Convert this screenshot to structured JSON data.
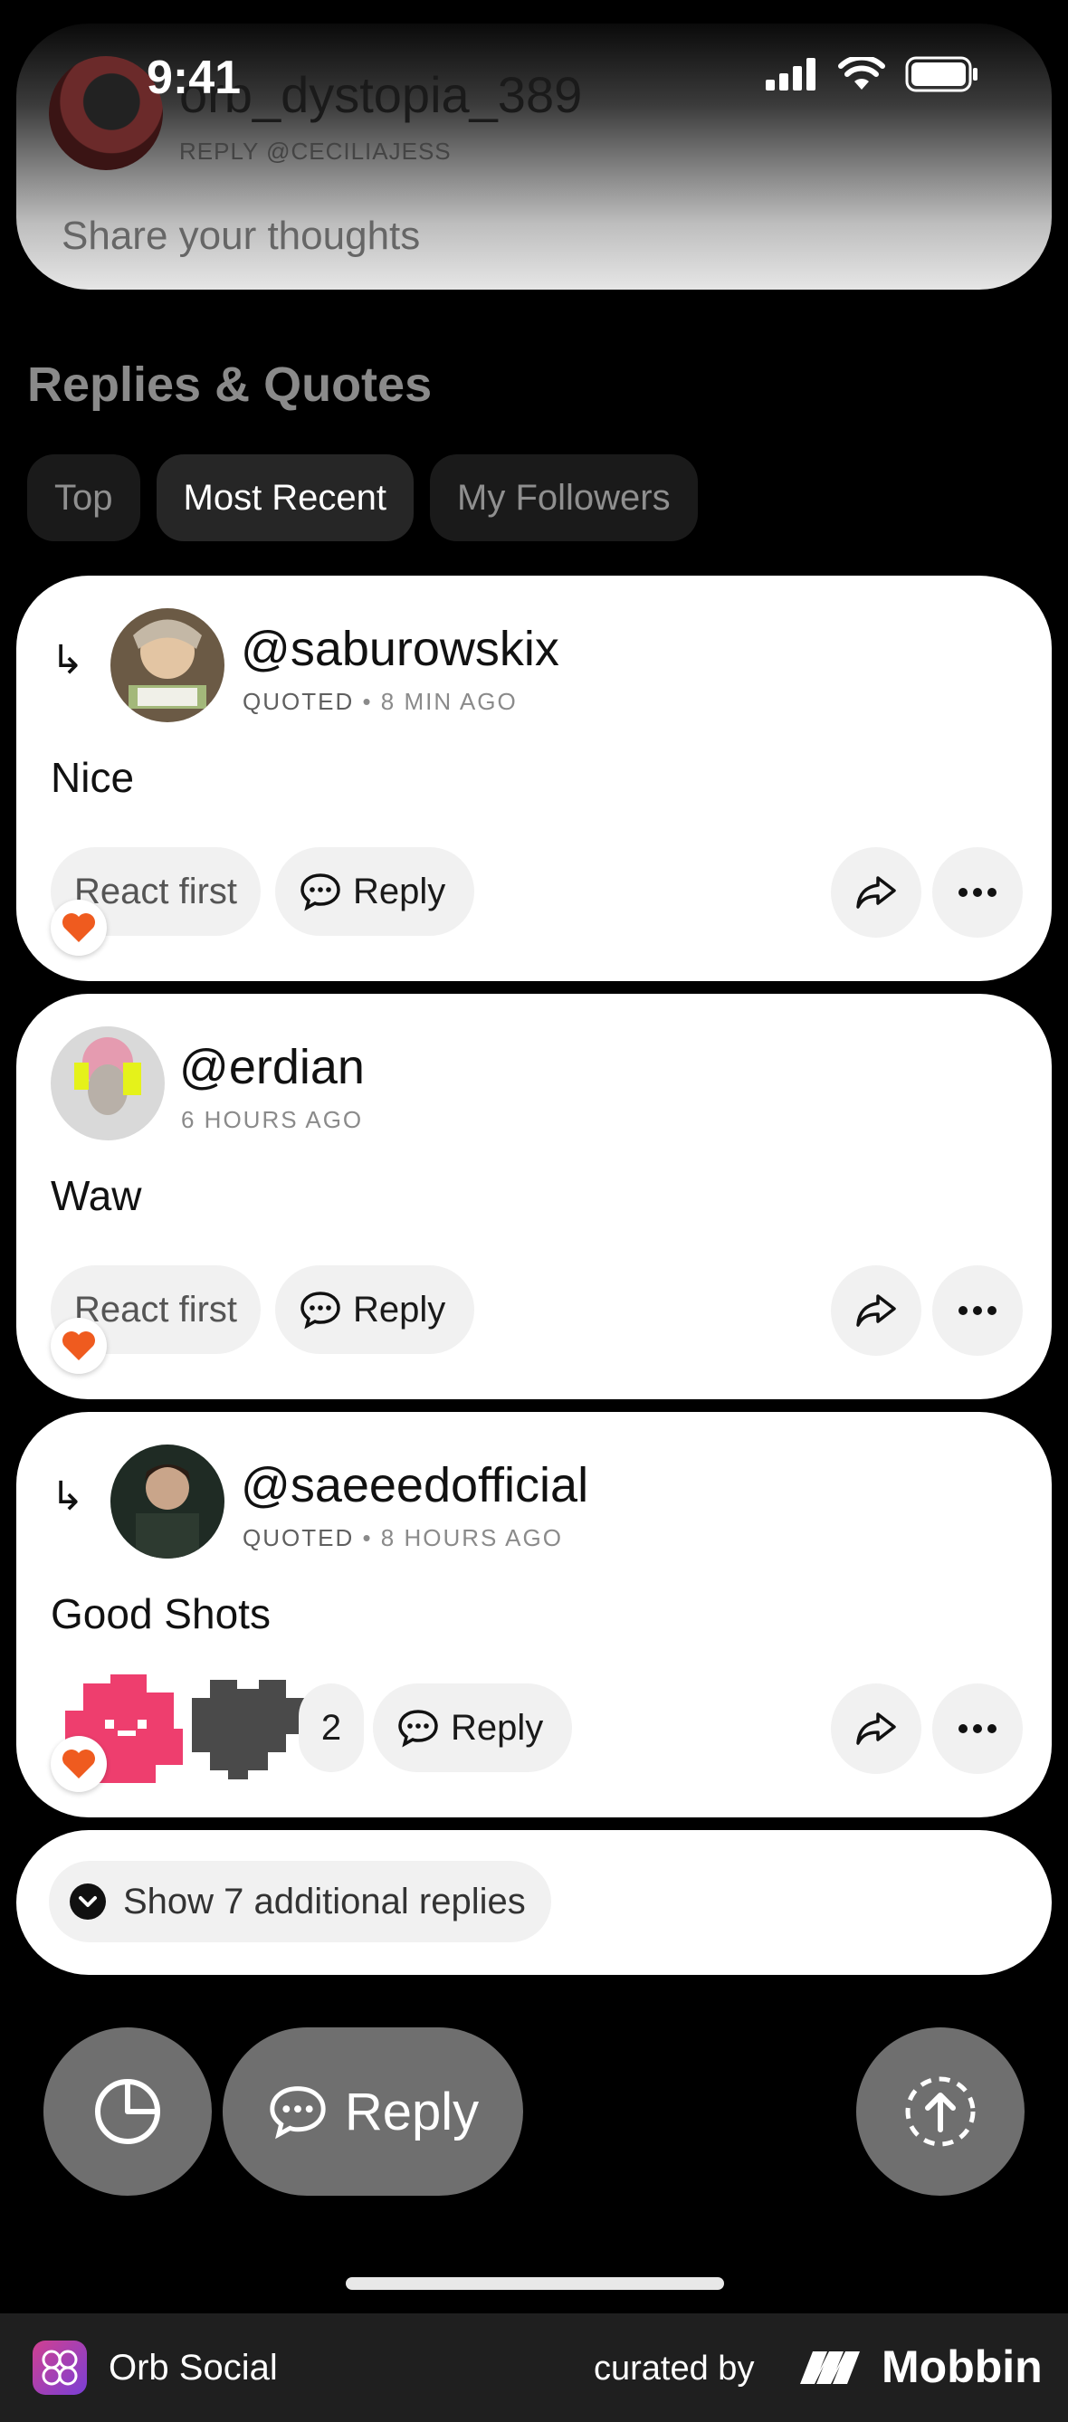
{
  "status_bar": {
    "time": "9:41"
  },
  "composer": {
    "username": "orb_dystopia_389",
    "reply_to": "REPLY @CECILIAJESS",
    "placeholder": "Share your thoughts"
  },
  "section": {
    "title": "Replies & Quotes"
  },
  "tabs": [
    {
      "label": "Top"
    },
    {
      "label": "Most Recent"
    },
    {
      "label": "My Followers"
    }
  ],
  "posts": [
    {
      "handle": "@saburowskix",
      "quoted": "QUOTED",
      "time": "8 MIN AGO",
      "text": "Nice",
      "react_label": "React first",
      "reply_label": "Reply"
    },
    {
      "handle": "@erdian",
      "time": "6 HOURS AGO",
      "text": "Waw",
      "react_label": "React first",
      "reply_label": "Reply"
    },
    {
      "handle": "@saeeedofficial",
      "quoted": "QUOTED",
      "time": "8 HOURS AGO",
      "text": "Good Shots",
      "reaction_count": "2",
      "reply_label": "Reply"
    }
  ],
  "show_more": {
    "label": "Show 7 additional replies"
  },
  "bottom_bar": {
    "reply_label": "Reply"
  },
  "footer": {
    "app_name": "Orb Social",
    "curated_by": "curated by",
    "brand": "Mobbin"
  },
  "colors": {
    "accent_heart": "#ef5b1f",
    "reaction_pink": "#ee3e6e",
    "reaction_dark": "#4a4a4a"
  }
}
